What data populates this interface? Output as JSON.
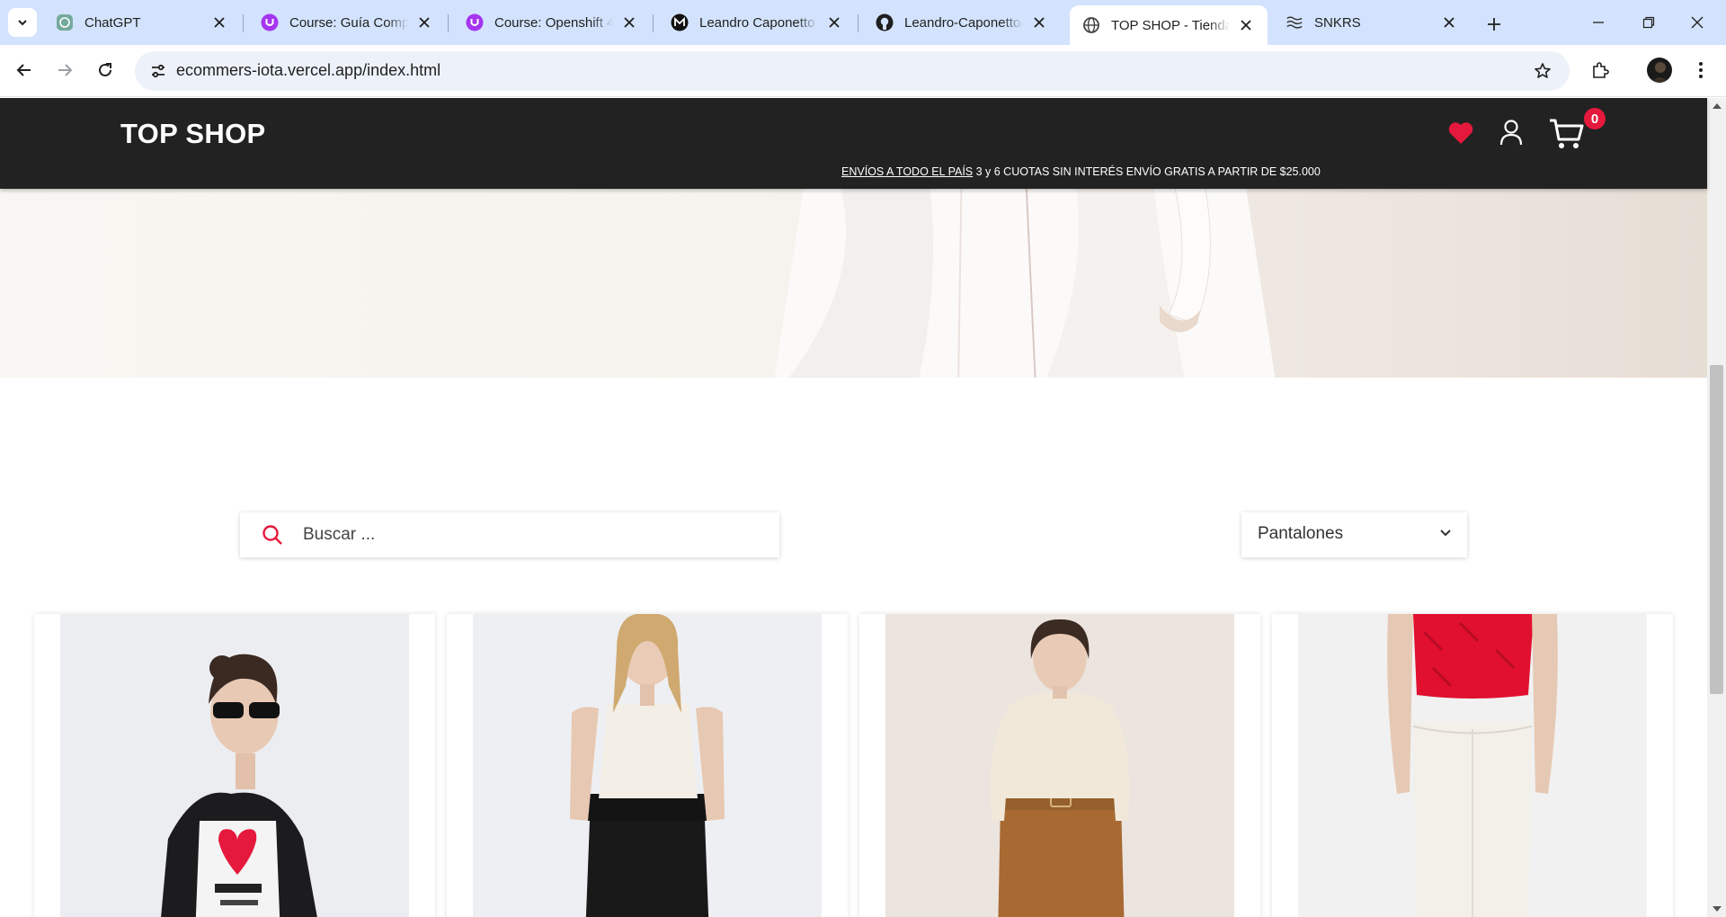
{
  "browser": {
    "tabs": [
      {
        "title": "ChatGPT",
        "icon": "chatgpt-icon"
      },
      {
        "title": "Course: Guía Completa",
        "icon": "udemy-icon"
      },
      {
        "title": "Course: Openshift 4 c",
        "icon": "udemy-icon"
      },
      {
        "title": "Leandro Caponetto |",
        "icon": "medium-icon"
      },
      {
        "title": "Leandro-Caponetto/",
        "icon": "github-icon"
      },
      {
        "title": "TOP SHOP - Tienda d",
        "icon": "globe-icon",
        "active": true
      },
      {
        "title": "SNKRS",
        "icon": "nike-icon"
      }
    ],
    "url": "ecommers-iota.vercel.app/index.html"
  },
  "site": {
    "brand": "TOP SHOP",
    "cart_count": "0",
    "promo_link": "ENVÍOS A TODO EL PAÍS",
    "promo_text": " 3 y 6 CUOTAS SIN INTERÉS ENVÍO GRATIS A PARTIR DE $25.000",
    "accent_color": "#e5193c",
    "header_bg": "#222222"
  },
  "filters": {
    "search_placeholder": "Buscar ...",
    "category_selected": "Pantalones"
  },
  "products": [
    {
      "image": "woman-leather-jacket-tokyo-tee"
    },
    {
      "image": "woman-white-cami-black-leather-pants"
    },
    {
      "image": "woman-cream-sweater-brown-pants"
    },
    {
      "image": "back-red-top-white-pants"
    }
  ]
}
